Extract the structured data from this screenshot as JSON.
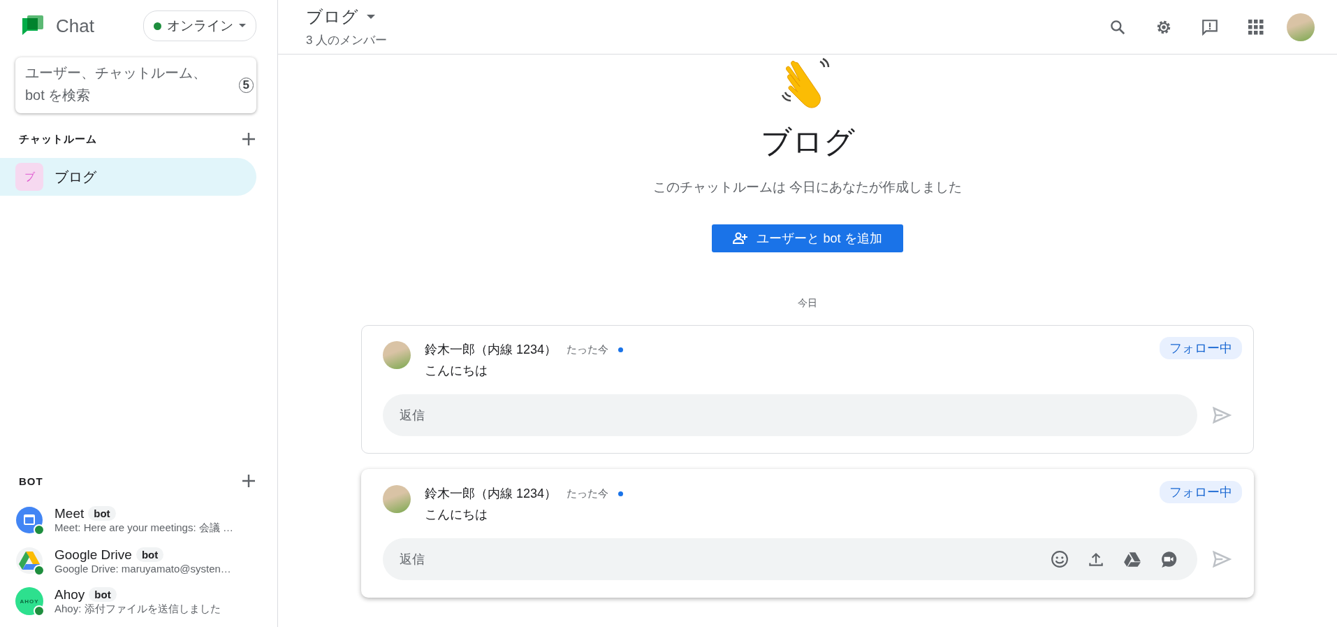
{
  "app": {
    "name": "Chat",
    "status": "オンライン"
  },
  "search": {
    "placeholder": "ユーザー、チャットルーム、bot を検索",
    "shortcut": "5"
  },
  "rooms": {
    "title": "チャットルーム",
    "items": [
      {
        "initial": "ブ",
        "name": "ブログ",
        "selected": true
      }
    ]
  },
  "bots": {
    "title": "BOT",
    "items": [
      {
        "kind": "meet",
        "name": "Meet",
        "tag": "bot",
        "preview": "Meet: Here are your meetings: 会議 …",
        "online": true
      },
      {
        "kind": "drive",
        "name": "Google Drive",
        "tag": "bot",
        "preview": "Google Drive: maruyamato@systen…",
        "online": true
      },
      {
        "kind": "ahoy",
        "logo_text": "AHOY",
        "name": "Ahoy",
        "tag": "bot",
        "preview": "Ahoy: 添付ファイルを送信しました",
        "online": true
      }
    ]
  },
  "header": {
    "title": "ブログ",
    "members": "3 人のメンバー"
  },
  "intro": {
    "title": "ブログ",
    "subtitle": "このチャットルームは 今日にあなたが作成しました",
    "button": "ユーザーと bot を追加"
  },
  "date": "今日",
  "threads": [
    {
      "author": "鈴木一郎（内線 1234）",
      "time": "たった今",
      "unread": true,
      "text": "こんにちは",
      "follow": "フォロー中",
      "reply_placeholder": "返信",
      "focused": false
    },
    {
      "author": "鈴木一郎（内線 1234）",
      "time": "たった今",
      "unread": true,
      "text": "こんにちは",
      "follow": "フォロー中",
      "reply_placeholder": "返信",
      "focused": true
    }
  ]
}
